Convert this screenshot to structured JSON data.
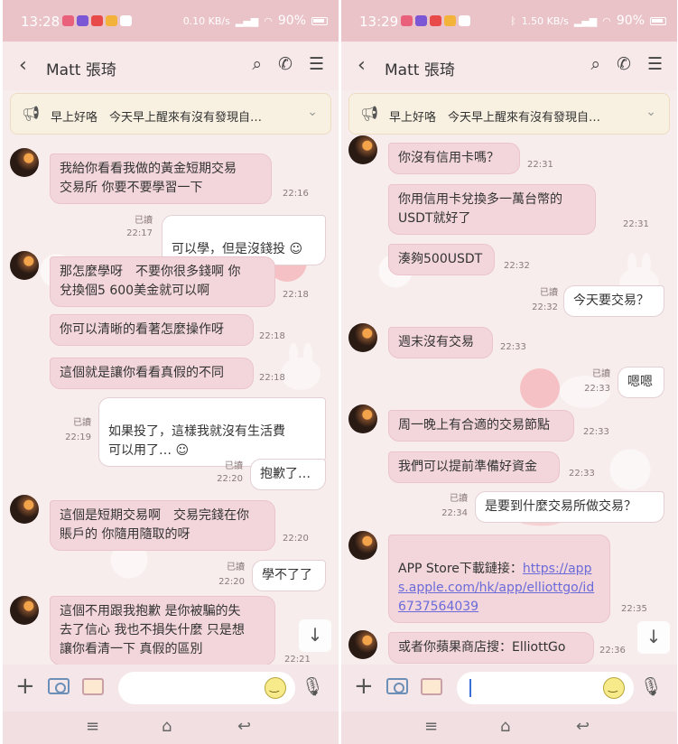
{
  "left": {
    "status": {
      "time": "13:28",
      "net": "0.10 KB/s",
      "battery": "90%"
    },
    "header": {
      "name": "Matt 張琦"
    },
    "announcement": "早上好咯　今天早上醒來有沒有發現自…",
    "messages": [
      {
        "dir": "in",
        "text": "我給你看看我做的黃金短期交易\n交易所 你要不要學習一下",
        "time": "22:16"
      },
      {
        "dir": "out",
        "text": "可以學，但是沒錢投",
        "read": "已讀",
        "time": "22:17"
      },
      {
        "dir": "in",
        "text": "那怎麼學呀　不要你很多錢啊 你\n兌換個5 600美金就可以啊",
        "time": "22:18"
      },
      {
        "dir": "in",
        "text": "你可以清晰的看著怎麼操作呀",
        "time": "22:18"
      },
      {
        "dir": "in",
        "text": "這個就是讓你看看真假的不同",
        "time": "22:18"
      },
      {
        "dir": "out",
        "text": "如果投了，這樣我就沒有生活費\n可以用了…",
        "read": "已讀",
        "time": "22:19"
      },
      {
        "dir": "out",
        "text": "抱歉了…",
        "read": "已讀",
        "time": "22:20"
      },
      {
        "dir": "in",
        "text": "這個是短期交易啊　交易完錢在你\n賬戶的 你隨用隨取的呀",
        "time": "22:20"
      },
      {
        "dir": "out",
        "text": "學不了了",
        "read": "已讀",
        "time": "22:20"
      },
      {
        "dir": "in",
        "text": "這個不用跟我抱歉 是你被騙的失\n去了信心 我也不損失什麼 只是想\n讓你看清一下 真假的區別",
        "time": "22:21"
      }
    ]
  },
  "right": {
    "status": {
      "time": "13:29",
      "net": "1.50 KB/s",
      "battery": "90%"
    },
    "header": {
      "name": "Matt 張琦"
    },
    "announcement": "早上好咯　今天早上醒來有沒有發現自…",
    "messages": [
      {
        "dir": "in",
        "text": "你沒有信用卡嗎？",
        "time": "22:31"
      },
      {
        "dir": "in",
        "text": "你用信用卡兌換多一萬台幣的\nUSDT就好了",
        "time": "22:31"
      },
      {
        "dir": "in",
        "text": "湊夠500USDT",
        "time": "22:32"
      },
      {
        "dir": "out",
        "text": "今天要交易？",
        "read": "已讀",
        "time": "22:32"
      },
      {
        "dir": "in",
        "text": "週末沒有交易",
        "time": "22:33"
      },
      {
        "dir": "out",
        "text": "嗯嗯",
        "read": "已讀",
        "time": "22:33"
      },
      {
        "dir": "in",
        "text": "周一晚上有合適的交易節點",
        "time": "22:33"
      },
      {
        "dir": "in",
        "text": "我們可以提前準備好資金",
        "time": "22:33"
      },
      {
        "dir": "out",
        "text": "是要到什麼交易所做交易？",
        "read": "已讀",
        "time": "22:34"
      },
      {
        "dir": "in",
        "text": "APP Store下載鏈接：",
        "link": "https://apps.apple.com/hk/app/elliottgo/id6737564039",
        "time": "22:35"
      },
      {
        "dir": "in",
        "text": "或者你蘋果商店搜：ElliottGo",
        "time": "22:36"
      }
    ]
  }
}
